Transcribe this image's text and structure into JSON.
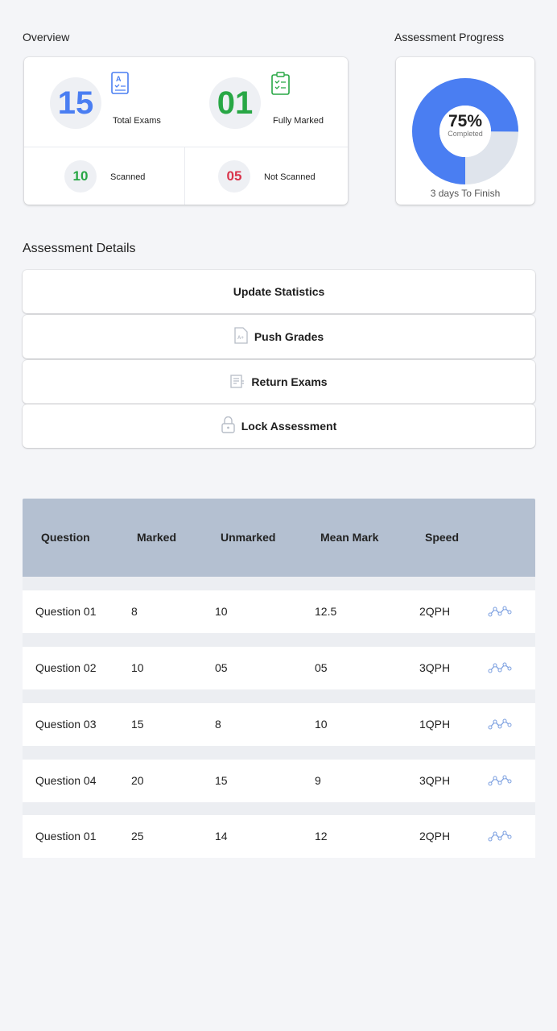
{
  "overview": {
    "title": "Overview",
    "total_exams": {
      "value": "15",
      "label": "Total Exams"
    },
    "fully_marked": {
      "value": "01",
      "label": "Fully Marked"
    },
    "scanned": {
      "value": "10",
      "label": "Scanned"
    },
    "not_scanned": {
      "value": "05",
      "label": "Not Scanned"
    }
  },
  "progress": {
    "title": "Assessment Progress",
    "percent_text": "75%",
    "percent_value": 75,
    "completed_label": "Completed",
    "finish_text": "3 days To Finish"
  },
  "details": {
    "title": "Assessment Details",
    "buttons": [
      {
        "label": "Update Statistics",
        "icon": "none"
      },
      {
        "label": "Push Grades",
        "icon": "grade-file-icon"
      },
      {
        "label": "Return Exams",
        "icon": "return-exams-icon"
      },
      {
        "label": "Lock Assessment",
        "icon": "lock-icon"
      }
    ]
  },
  "table": {
    "headers": [
      "Question",
      "Marked",
      "Unmarked",
      "Mean Mark",
      "Speed"
    ],
    "rows": [
      {
        "question": "Question 01",
        "marked": "8",
        "unmarked": "10",
        "mean": "12.5",
        "speed": "2QPH"
      },
      {
        "question": "Question 02",
        "marked": "10",
        "unmarked": "05",
        "mean": "05",
        "speed": "3QPH"
      },
      {
        "question": "Question 03",
        "marked": "15",
        "unmarked": "8",
        "mean": "10",
        "speed": "1QPH"
      },
      {
        "question": "Question 04",
        "marked": "20",
        "unmarked": "15",
        "mean": "9",
        "speed": "3QPH"
      },
      {
        "question": "Question 01",
        "marked": "25",
        "unmarked": "14",
        "mean": "12",
        "speed": "2QPH"
      }
    ]
  },
  "colors": {
    "blue": "#4a7ef2",
    "green": "#28a745",
    "red": "#d9344b",
    "header_bg": "#b4c0d1",
    "donut_track": "#dfe4ec"
  }
}
